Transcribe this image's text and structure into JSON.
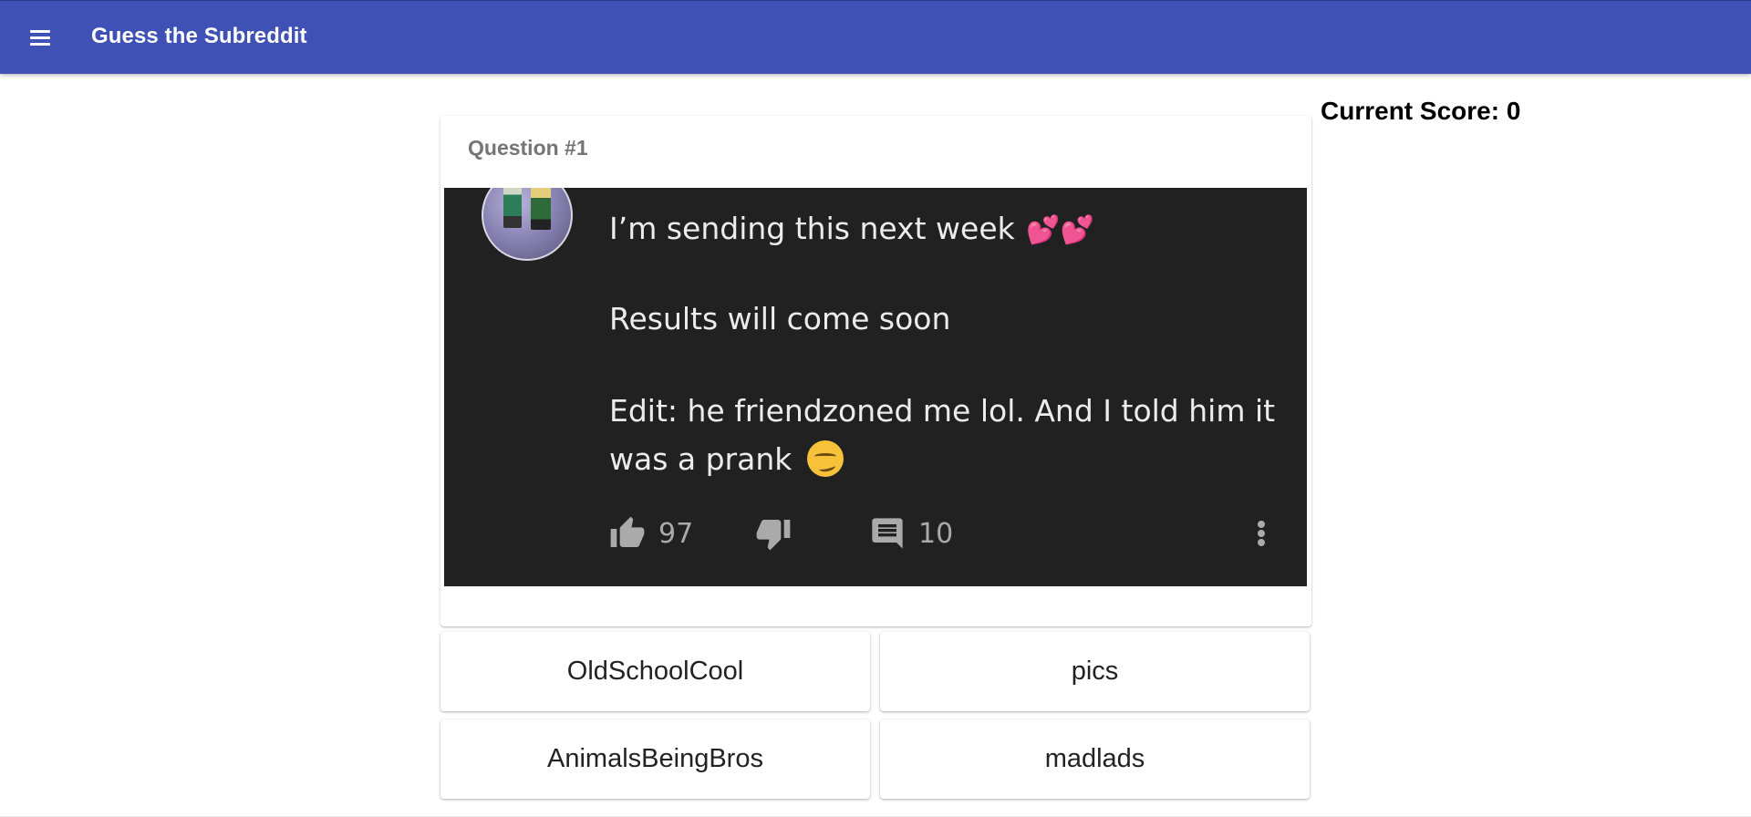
{
  "appbar": {
    "title": "Guess the Subreddit",
    "menu_icon": "menu-icon",
    "color": "#3f51b5"
  },
  "score": {
    "label": "Current Score: 0"
  },
  "question": {
    "label": "Question #1",
    "post": {
      "lines": [
        "I’m sending this next week",
        "Results will come soon",
        "Edit: he friendzoned me lol. And I told him it",
        "was a prank"
      ],
      "emoji_hearts": "💕💕",
      "likes": "97",
      "comments": "10",
      "background": "#212121"
    }
  },
  "answers": [
    {
      "label": "OldSchoolCool"
    },
    {
      "label": "pics"
    },
    {
      "label": "AnimalsBeingBros"
    },
    {
      "label": "madlads"
    }
  ]
}
